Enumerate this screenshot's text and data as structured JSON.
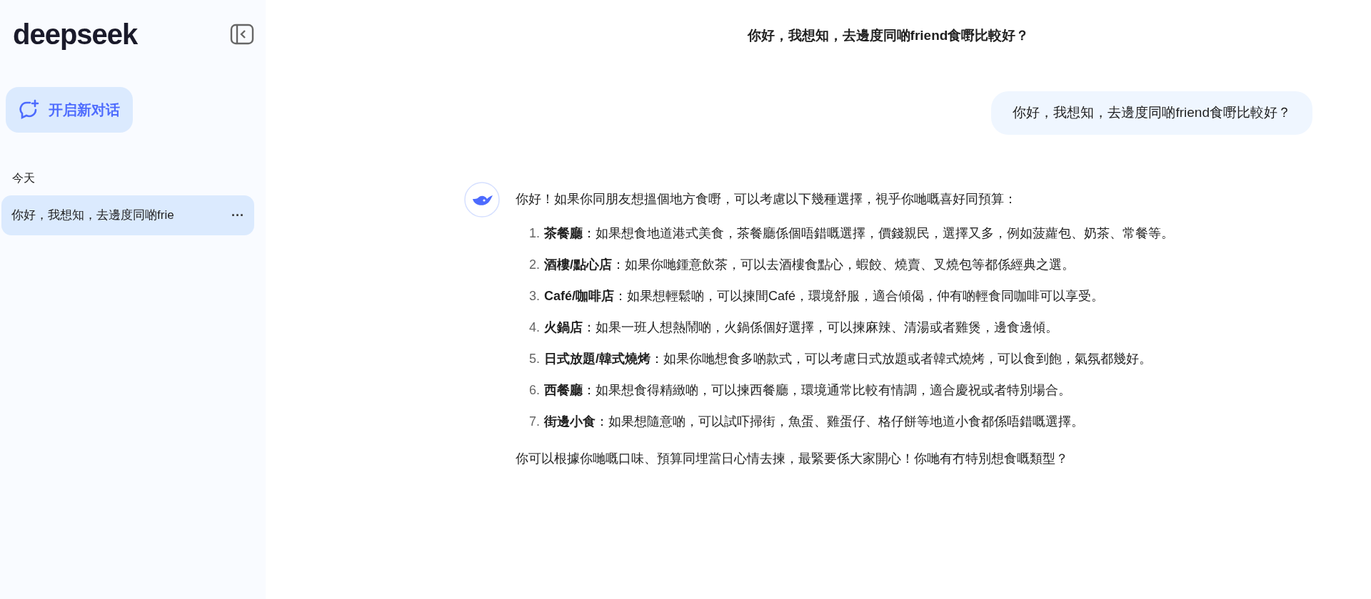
{
  "sidebar": {
    "logo": "deepseek",
    "new_chat_button": "开启新对话",
    "section_label": "今天",
    "conversations": [
      {
        "title": "你好，我想知，去邊度同啲frie",
        "more": "···",
        "selected": true
      }
    ]
  },
  "chat": {
    "title": "你好，我想知，去邊度同啲friend食嘢比較好？",
    "user_message": "你好，我想知，去邊度同啲friend食嘢比較好？",
    "assistant": {
      "intro": "你好！如果你同朋友想搵個地方食嘢，可以考慮以下幾種選擇，視乎你哋嘅喜好同預算：",
      "items": [
        {
          "number": "1.",
          "title": "茶餐廳",
          "text": "：如果想食地道港式美食，茶餐廳係個唔錯嘅選擇，價錢親民，選擇又多，例如菠蘿包、奶茶、常餐等。"
        },
        {
          "number": "2.",
          "title": "酒樓/點心店",
          "text": "：如果你哋鍾意飲茶，可以去酒樓食點心，蝦餃、燒賣、叉燒包等都係經典之選。"
        },
        {
          "number": "3.",
          "title": "Café/咖啡店",
          "text": "：如果想輕鬆啲，可以揀間Café，環境舒服，適合傾偈，仲有啲輕食同咖啡可以享受。"
        },
        {
          "number": "4.",
          "title": "火鍋店",
          "text": "：如果一班人想熱鬧啲，火鍋係個好選擇，可以揀麻辣、清湯或者雞煲，邊食邊傾。"
        },
        {
          "number": "5.",
          "title": "日式放題/韓式燒烤",
          "text": "：如果你哋想食多啲款式，可以考慮日式放題或者韓式燒烤，可以食到飽，氣氛都幾好。"
        },
        {
          "number": "6.",
          "title": "西餐廳",
          "text": "：如果想食得精緻啲，可以揀西餐廳，環境通常比較有情調，適合慶祝或者特別場合。"
        },
        {
          "number": "7.",
          "title": "街邊小食",
          "text": "：如果想隨意啲，可以試吓掃街，魚蛋、雞蛋仔、格仔餅等地道小食都係唔錯嘅選擇。"
        }
      ],
      "closing": "你可以根據你哋嘅口味、預算同埋當日心情去揀，最緊要係大家開心！你哋有冇特別想食嘅類型？"
    }
  }
}
